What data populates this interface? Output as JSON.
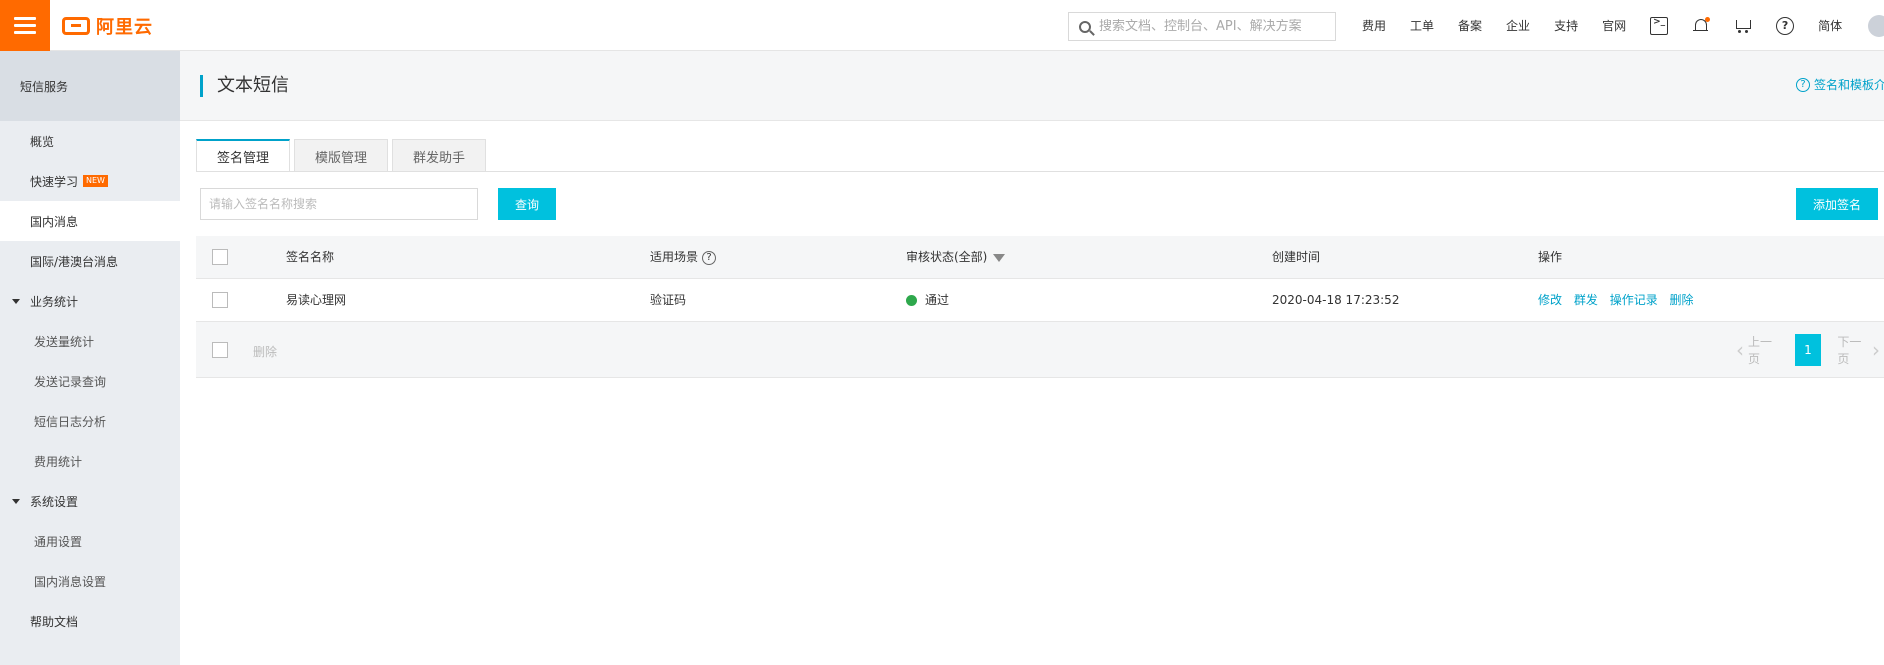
{
  "topbar": {
    "logo_text": "阿里云",
    "search_placeholder": "搜索文档、控制台、API、解决方案",
    "nav": [
      "费用",
      "工单",
      "备案",
      "企业",
      "支持",
      "官网"
    ],
    "lang": "简体"
  },
  "sidebar": {
    "title": "短信服务",
    "items": [
      {
        "label": "概览"
      },
      {
        "label": "快速学习",
        "badge": "NEW"
      },
      {
        "label": "国内消息"
      },
      {
        "label": "国际/港澳台消息"
      }
    ],
    "group_stats": "业务统计",
    "stats_items": [
      "发送量统计",
      "发送记录查询",
      "短信日志分析",
      "费用统计"
    ],
    "group_settings": "系统设置",
    "settings_items": [
      "通用设置",
      "国内消息设置"
    ],
    "help": "帮助文档"
  },
  "page": {
    "title": "文本短信",
    "help_link": "签名和模板介"
  },
  "tabs": [
    "签名管理",
    "模版管理",
    "群发助手"
  ],
  "toolbar": {
    "input_placeholder": "请输入签名名称搜索",
    "query_label": "查询",
    "add_label": "添加签名"
  },
  "table": {
    "columns": {
      "name": "签名名称",
      "scene": "适用场景",
      "status": "审核状态(全部)",
      "created": "创建时间",
      "ops": "操作"
    },
    "rows": [
      {
        "name": "易读心理网",
        "scene": "验证码",
        "status": "通过",
        "created": "2020-04-18 17:23:52",
        "ops": [
          "修改",
          "群发",
          "操作记录",
          "删除"
        ]
      }
    ]
  },
  "footer": {
    "delete_label": "删除",
    "prev_label": "上一页",
    "page": "1",
    "next_label": "下一页"
  }
}
